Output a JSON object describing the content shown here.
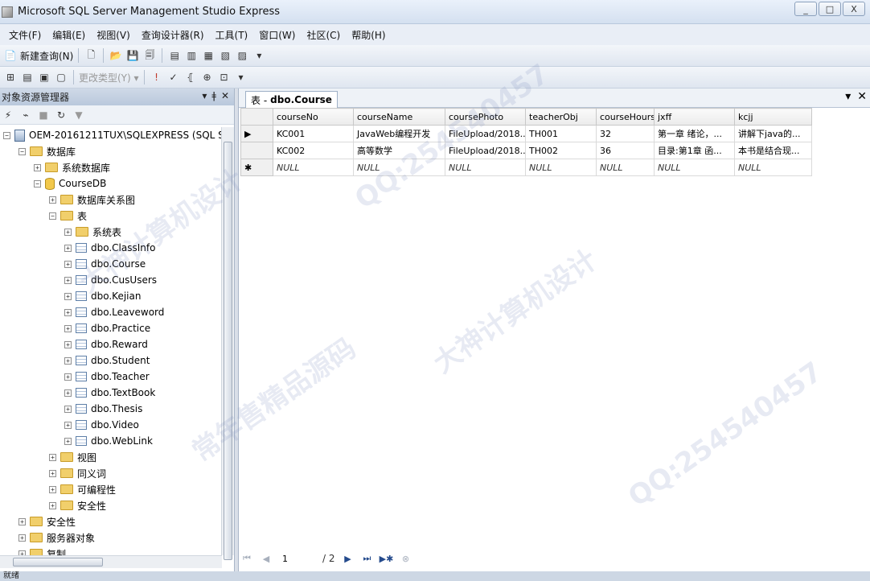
{
  "window": {
    "title": "Microsoft SQL Server Management Studio Express",
    "controls": [
      "_",
      "□",
      "X"
    ]
  },
  "menu": [
    "文件(F)",
    "编辑(E)",
    "视图(V)",
    "查询设计器(R)",
    "工具(T)",
    "窗口(W)",
    "社区(C)",
    "帮助(H)"
  ],
  "toolbar": {
    "new_query": "新建查询(N)",
    "change_type": "更改类型(Y) ▾"
  },
  "object_explorer": {
    "title": "对象资源管理器",
    "header_buttons": [
      "▾",
      "ǂ",
      "✕"
    ],
    "tree": [
      {
        "label": "OEM-20161211TUX\\SQLEXPRESS (SQL S",
        "icon": "server",
        "exp": "−",
        "level": 0
      },
      {
        "label": "数据库",
        "icon": "folder",
        "exp": "−",
        "level": 1
      },
      {
        "label": "系统数据库",
        "icon": "folder",
        "exp": "+",
        "level": 2
      },
      {
        "label": "CourseDB",
        "icon": "database",
        "exp": "−",
        "level": 2
      },
      {
        "label": "数据库关系图",
        "icon": "folder",
        "exp": "+",
        "level": 3
      },
      {
        "label": "表",
        "icon": "folder",
        "exp": "−",
        "level": 3
      },
      {
        "label": "系统表",
        "icon": "folder",
        "exp": "+",
        "level": 4
      },
      {
        "label": "dbo.ClassInfo",
        "icon": "table",
        "exp": "+",
        "level": 4
      },
      {
        "label": "dbo.Course",
        "icon": "table",
        "exp": "+",
        "level": 4
      },
      {
        "label": "dbo.CusUsers",
        "icon": "table",
        "exp": "+",
        "level": 4
      },
      {
        "label": "dbo.Kejian",
        "icon": "table",
        "exp": "+",
        "level": 4
      },
      {
        "label": "dbo.Leaveword",
        "icon": "table",
        "exp": "+",
        "level": 4
      },
      {
        "label": "dbo.Practice",
        "icon": "table",
        "exp": "+",
        "level": 4
      },
      {
        "label": "dbo.Reward",
        "icon": "table",
        "exp": "+",
        "level": 4
      },
      {
        "label": "dbo.Student",
        "icon": "table",
        "exp": "+",
        "level": 4
      },
      {
        "label": "dbo.Teacher",
        "icon": "table",
        "exp": "+",
        "level": 4
      },
      {
        "label": "dbo.TextBook",
        "icon": "table",
        "exp": "+",
        "level": 4
      },
      {
        "label": "dbo.Thesis",
        "icon": "table",
        "exp": "+",
        "level": 4
      },
      {
        "label": "dbo.Video",
        "icon": "table",
        "exp": "+",
        "level": 4
      },
      {
        "label": "dbo.WebLink",
        "icon": "table",
        "exp": "+",
        "level": 4
      },
      {
        "label": "视图",
        "icon": "folder",
        "exp": "+",
        "level": 3
      },
      {
        "label": "同义词",
        "icon": "folder",
        "exp": "+",
        "level": 3
      },
      {
        "label": "可编程性",
        "icon": "folder",
        "exp": "+",
        "level": 3
      },
      {
        "label": "安全性",
        "icon": "folder",
        "exp": "+",
        "level": 3
      },
      {
        "label": "安全性",
        "icon": "folder",
        "exp": "+",
        "level": 1
      },
      {
        "label": "服务器对象",
        "icon": "folder",
        "exp": "+",
        "level": 1
      },
      {
        "label": "复制",
        "icon": "folder",
        "exp": "+",
        "level": 1
      }
    ]
  },
  "document": {
    "tab_prefix": "表 -",
    "tab_name": "dbo.Course",
    "tab_controls": [
      "▾",
      "✕"
    ],
    "columns": [
      "courseNo",
      "courseName",
      "coursePhoto",
      "teacherObj",
      "courseHours",
      "jxff",
      "kcjj"
    ],
    "rows": [
      {
        "marker": "▶",
        "cells": [
          "KC001",
          "JavaWeb编程开发",
          "FileUpload/2018...",
          "TH001",
          "32",
          "第一章 绪论，...",
          "讲解下java的..."
        ]
      },
      {
        "marker": "",
        "cells": [
          "KC002",
          "高等数学",
          "FileUpload/2018...",
          "TH002",
          "36",
          "目录:第1章 函...",
          "本书是结合现..."
        ]
      },
      {
        "marker": "✱",
        "cells": [
          "NULL",
          "NULL",
          "NULL",
          "NULL",
          "NULL",
          "NULL",
          "NULL"
        ],
        "null": true
      }
    ],
    "pager": {
      "current": "1",
      "total": "/ 2"
    }
  },
  "status": "就绪",
  "watermark_texts": [
    "QQ:254540457",
    "大神计算机设计",
    "常年售精品源码"
  ]
}
